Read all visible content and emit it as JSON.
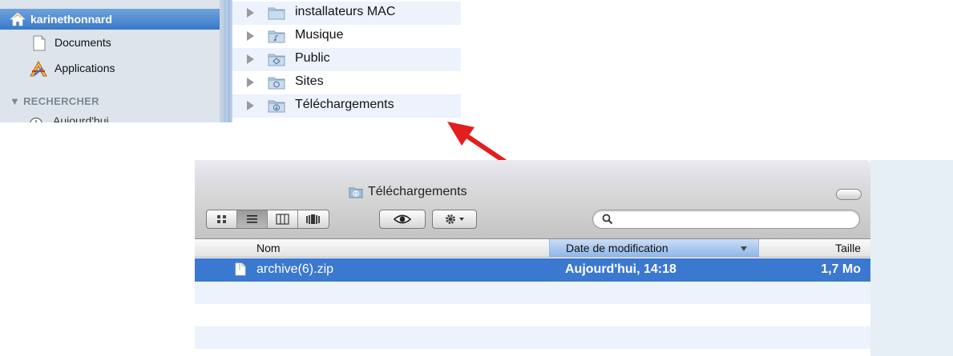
{
  "top": {
    "sidebar": {
      "items": [
        {
          "label": "karinethonnard",
          "icon": "home-icon"
        },
        {
          "label": "Documents",
          "icon": "document-icon"
        },
        {
          "label": "Applications",
          "icon": "applications-icon"
        }
      ],
      "section_header": "▼ RECHERCHER",
      "cut_item": "Aujourd'hui"
    },
    "columns": {
      "rows": [
        {
          "label": "installateurs MAC",
          "icon": "folder-icon"
        },
        {
          "label": "Musique",
          "icon": "music-folder-icon"
        },
        {
          "label": "Public",
          "icon": "public-folder-icon"
        },
        {
          "label": "Sites",
          "icon": "sites-folder-icon"
        },
        {
          "label": "Téléchargements",
          "icon": "downloads-folder-icon"
        }
      ]
    }
  },
  "window": {
    "title": "Téléchargements",
    "search": {
      "value": "",
      "placeholder": ""
    },
    "columns": {
      "name": "Nom",
      "date": "Date de modification",
      "size": "Taille"
    },
    "files": [
      {
        "name": "archive(6).zip",
        "date": "Aujourd'hui, 14:18",
        "size": "1,7 Mo"
      }
    ]
  },
  "colors": {
    "selection": "#3b78d0",
    "sidebar_bg": "#dde4ec",
    "arrow": "#e31e1e",
    "alt_row": "#edf3fd"
  }
}
